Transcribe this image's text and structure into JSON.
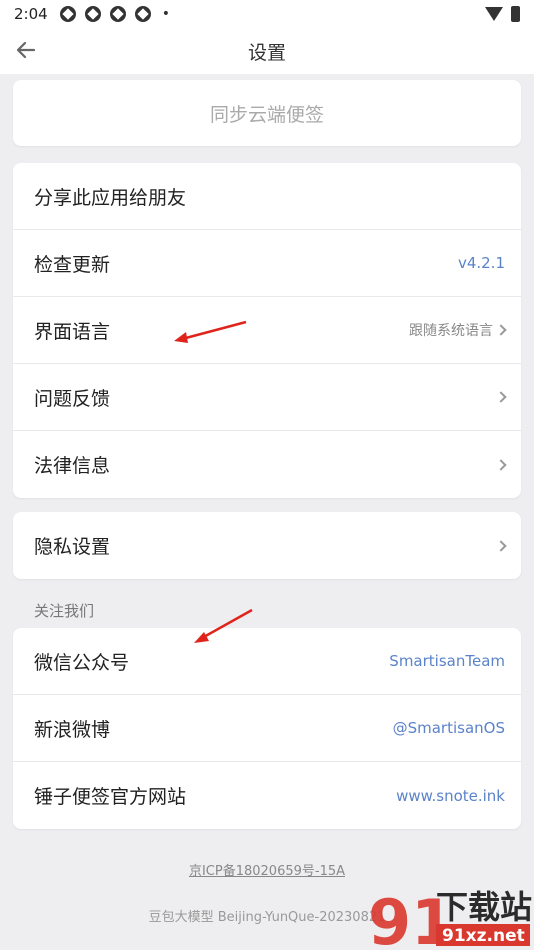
{
  "status_bar": {
    "time": "2:04",
    "dot": "•"
  },
  "header": {
    "title": "设置"
  },
  "sync": {
    "label": "同步云端便签"
  },
  "general": {
    "share": "分享此应用给朋友",
    "check_update": "检查更新",
    "version": "v4.2.1",
    "language": "界面语言",
    "language_value": "跟随系统语言",
    "feedback": "问题反馈",
    "legal": "法律信息"
  },
  "privacy": {
    "label": "隐私设置"
  },
  "follow": {
    "section_title": "关注我们",
    "wechat": "微信公众号",
    "wechat_value": "SmartisanTeam",
    "weibo": "新浪微博",
    "weibo_value": "@SmartisanOS",
    "website": "锤子便签官方网站",
    "website_value": "www.snote.ink"
  },
  "footer": {
    "icp": "京ICP备18020659号-15A",
    "model": "豆包大模型 Beijing-YunQue-20230821"
  },
  "watermark": {
    "brand_cn": "下载站",
    "brand_url": "91xz.net",
    "digits": "91"
  },
  "colors": {
    "accent": "#5b83c9",
    "annotation_arrow": "#e0241c",
    "background": "#eeeef0"
  }
}
